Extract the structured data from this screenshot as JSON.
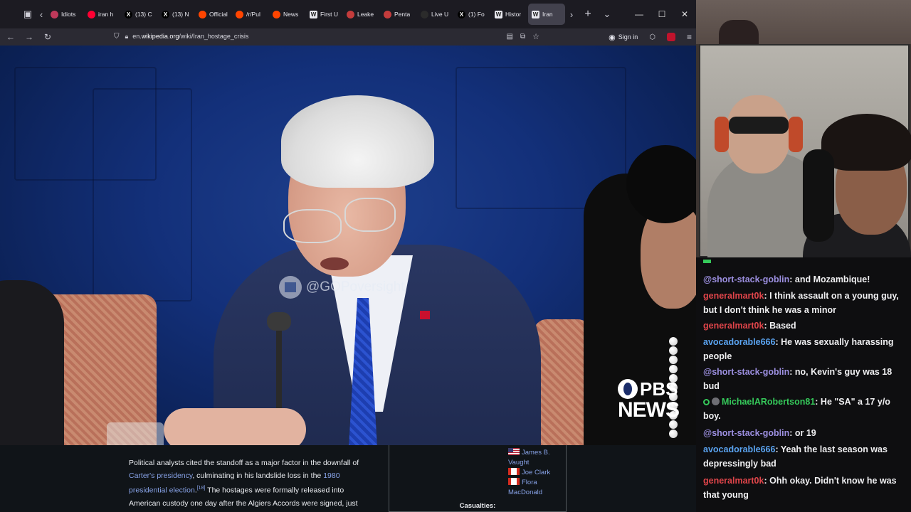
{
  "browser": {
    "tabs": [
      {
        "title": "Idiots",
        "favicon": "bookmark-icon",
        "color": "#c0395b"
      },
      {
        "title": "iran h",
        "favicon": "youtube-icon",
        "color": "#ff0033"
      },
      {
        "title": "(13) C",
        "favicon": "x-icon",
        "color": "#000000"
      },
      {
        "title": "(13) N",
        "favicon": "x-icon",
        "color": "#000000"
      },
      {
        "title": "Official",
        "favicon": "reddit-icon",
        "color": "#ff4500"
      },
      {
        "title": "/r/Pul",
        "favicon": "reddit-icon",
        "color": "#ff4500"
      },
      {
        "title": "News",
        "favicon": "reddit-icon",
        "color": "#ff4500"
      },
      {
        "title": "First U",
        "favicon": "wikipedia-icon",
        "color": "#e8e8ef"
      },
      {
        "title": "Leake",
        "favicon": "globe-icon",
        "color": "#c43c3c"
      },
      {
        "title": "Penta",
        "favicon": "globe-icon",
        "color": "#c43c3c"
      },
      {
        "title": "Live U",
        "favicon": "globe-icon",
        "color": "#2b2b2b"
      },
      {
        "title": "(1) Fo",
        "favicon": "x-icon",
        "color": "#000000"
      },
      {
        "title": "Histor",
        "favicon": "wikipedia-icon",
        "color": "#e8e8ef"
      },
      {
        "title": "Iran",
        "favicon": "wikipedia-icon",
        "color": "#e8e8ef"
      }
    ],
    "url_prefix": "en.",
    "url_domain": "wikipedia.org",
    "url_path": "/wiki/Iran_hostage_crisis",
    "signin_label": "Sign in"
  },
  "article": {
    "text_1": "Political analysts cited the standoff as a major factor in the downfall of ",
    "link_1": "Carter's presidency",
    "text_2": ", culminating in his landslide loss in the ",
    "link_2": "1980 presidential election",
    "ref": "[18]",
    "text_3": " The hostages were formally released into American custody one day after the Algiers Accords were signed, just"
  },
  "infobox": {
    "entries": [
      "James B. Vaught",
      "Joe Clark",
      "Flora MacDonald"
    ],
    "casualties_label": "Casualties:"
  },
  "video": {
    "watermark": "@GOPoversight",
    "network_top": "PBS",
    "network_bottom": "NEWS"
  },
  "chat": {
    "messages": [
      {
        "user": "@short-stack-goblin",
        "text": ": and Mozambique!",
        "color": "#9c8fe0"
      },
      {
        "user": "generalmart0k",
        "text": ": I think assault on a young guy, but I don't think he was a minor",
        "color": "#e0454a"
      },
      {
        "user": "generalmart0k",
        "text": ": Based",
        "color": "#e0454a"
      },
      {
        "user": "avocadorable666",
        "text": ": He was sexually harassing people",
        "color": "#5aa3f0"
      },
      {
        "user": "@short-stack-goblin",
        "text": ": no, Kevin's guy was 18 bud",
        "color": "#9c8fe0"
      },
      {
        "user": "MichaelARobertson81",
        "text": ": He \"SA\" a 17 y/o boy.",
        "color": "#35c95a"
      },
      {
        "user": "@short-stack-goblin",
        "text": ": or 19",
        "color": "#9c8fe0"
      },
      {
        "user": "avocadorable666",
        "text": ": Yeah the last season was depressingly bad",
        "color": "#5aa3f0"
      },
      {
        "user": "generalmart0k",
        "text": ": Ohh okay. Didn't know he was that young",
        "color": "#e0454a"
      }
    ]
  }
}
